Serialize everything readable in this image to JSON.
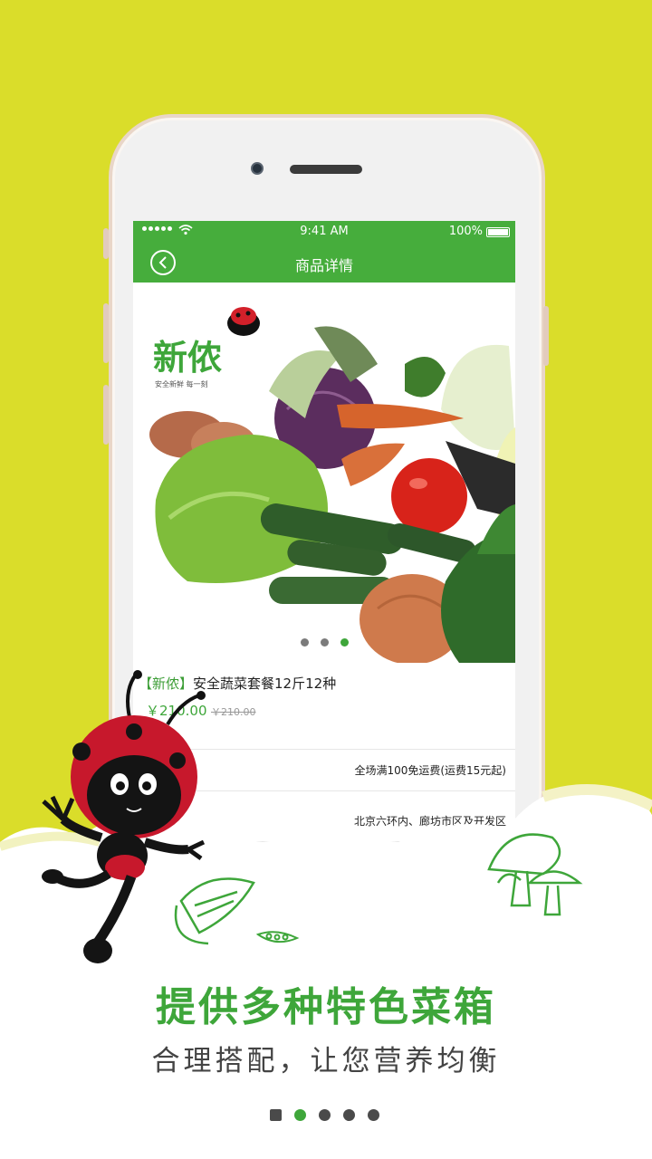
{
  "colors": {
    "background": "#dadd2a",
    "brand_green": "#46ad3c",
    "accent_green": "#3ea63a"
  },
  "status_bar": {
    "signal": "●●●●●",
    "time": "9:41 AM",
    "battery": "100%"
  },
  "nav": {
    "title": "商品详情",
    "back_icon": "back-circle-icon"
  },
  "product": {
    "brand_tag": "【新侬】",
    "name": "安全蔬菜套餐12斤12种",
    "price": "￥210.00",
    "old_price": "￥210.00",
    "logo_text": "新侬",
    "logo_slogan": "安全新鲜 每一刻"
  },
  "carousel": {
    "count": 3,
    "active": 2
  },
  "shipping": {
    "note": "全场满100免运费(运费15元起)"
  },
  "delivery": {
    "area": "北京六环内、廊坊市区及开发区"
  },
  "headline": "提供多种特色菜箱",
  "subline": "合理搭配，让您营养均衡",
  "guide": {
    "count": 5,
    "active": 1
  }
}
